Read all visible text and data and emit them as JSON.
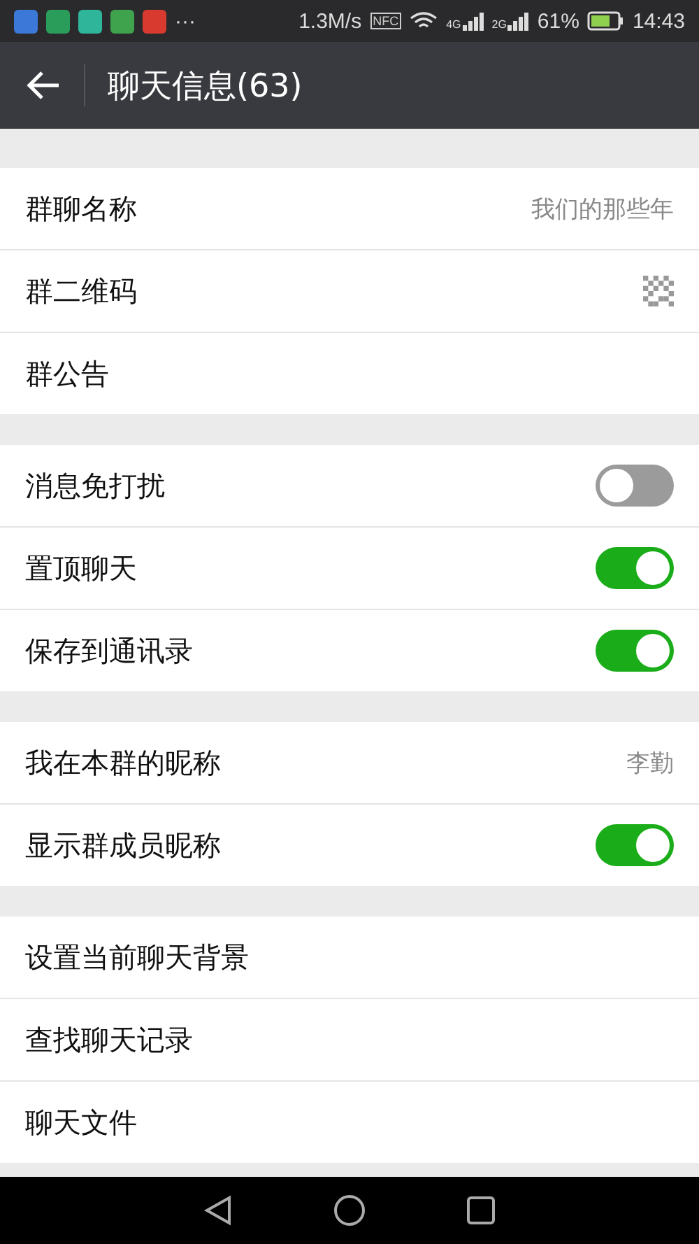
{
  "status_bar": {
    "speed": "1.3M/s",
    "nfc": "NFC",
    "net1": "4G",
    "net2": "2G",
    "battery": "61%",
    "time": "14:43",
    "more": "···"
  },
  "header": {
    "title": "聊天信息(63)"
  },
  "groups": [
    {
      "rows": [
        {
          "kind": "value",
          "label": "群聊名称",
          "value": "我们的那些年"
        },
        {
          "kind": "qr",
          "label": "群二维码"
        },
        {
          "kind": "plain",
          "label": "群公告"
        }
      ]
    },
    {
      "rows": [
        {
          "kind": "toggle",
          "label": "消息免打扰",
          "on": false
        },
        {
          "kind": "toggle",
          "label": "置顶聊天",
          "on": true
        },
        {
          "kind": "toggle",
          "label": "保存到通讯录",
          "on": true
        }
      ]
    },
    {
      "rows": [
        {
          "kind": "value",
          "label": "我在本群的昵称",
          "value": "李勤"
        },
        {
          "kind": "toggle",
          "label": "显示群成员昵称",
          "on": true
        }
      ]
    },
    {
      "rows": [
        {
          "kind": "plain",
          "label": "设置当前聊天背景"
        },
        {
          "kind": "plain",
          "label": "查找聊天记录"
        },
        {
          "kind": "plain",
          "label": "聊天文件"
        }
      ]
    }
  ]
}
